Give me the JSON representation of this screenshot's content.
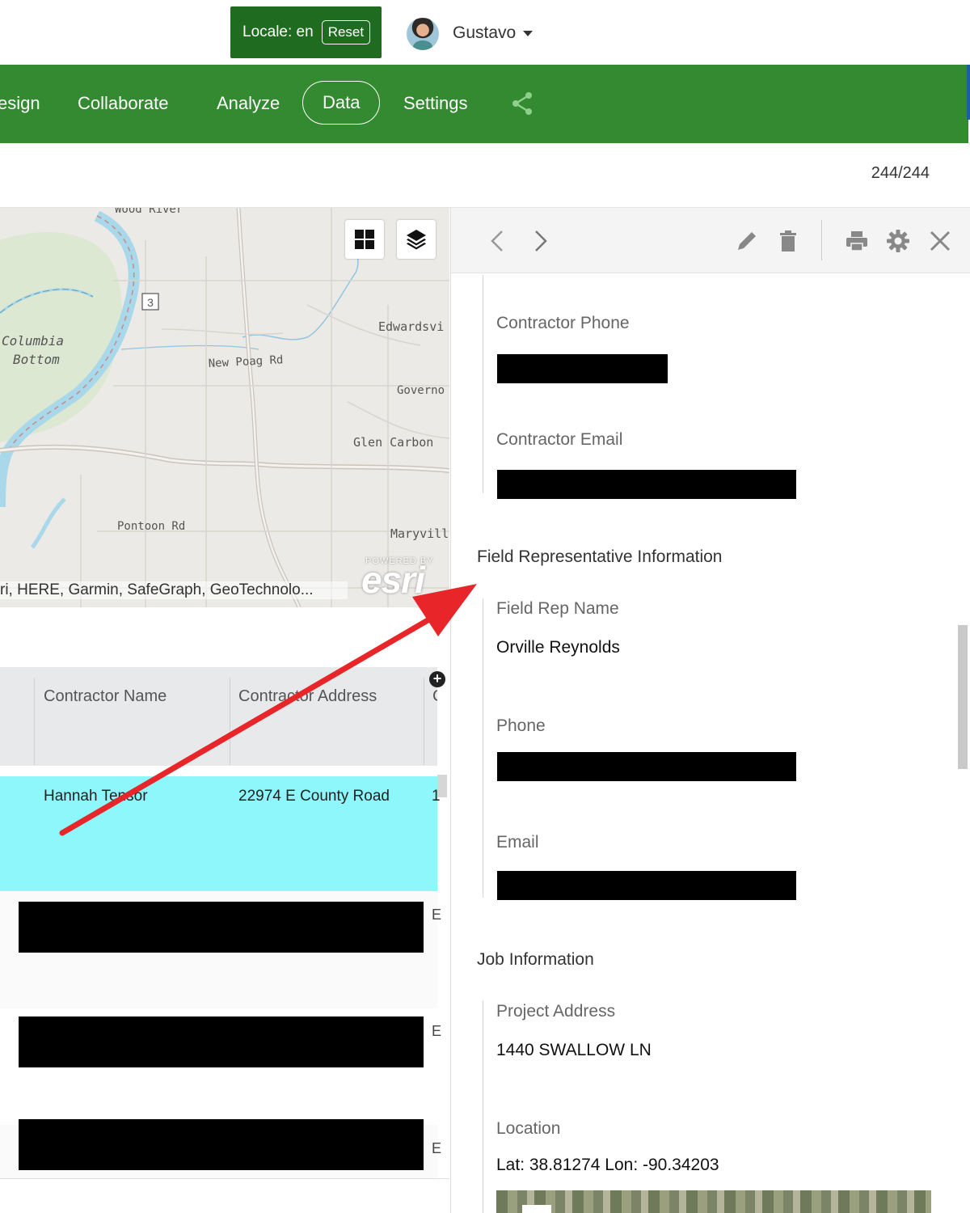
{
  "header": {
    "locale_label": "Locale: en",
    "reset_label": "Reset",
    "user_name": "Gustavo"
  },
  "nav": {
    "items": [
      {
        "label": "esign"
      },
      {
        "label": "Collaborate"
      },
      {
        "label": "Analyze"
      },
      {
        "label": "Data"
      },
      {
        "label": "Settings"
      }
    ],
    "active": "Data",
    "share_icon": "share-icon",
    "color": "#338a30"
  },
  "record_counter": "244/244",
  "map": {
    "labels": {
      "wood_river": "Wood River",
      "columbia_bottom_1": "Columbia",
      "columbia_bottom_2": "Bottom",
      "edwardsville": "Edwardsvi",
      "new_poag": "New Poag Rd",
      "governor": "Governo",
      "glen_carbon": "Glen Carbon",
      "pontoon": "Pontoon Rd",
      "maryville": "Maryville",
      "route": "3"
    },
    "attribution": "ri, HERE, Garmin, SafeGraph, GeoTechnolo...",
    "powered_by": "POWERED BY",
    "esri": "esri",
    "buttons": [
      "grid-icon",
      "layers-icon"
    ]
  },
  "table": {
    "columns": [
      "Contractor Name",
      "Contractor Address"
    ],
    "selected_row": {
      "contractor_name": "Hannah Tensor",
      "contractor_address": "22974 E County Road",
      "extra": "1"
    },
    "row_fragments": [
      "E",
      "E",
      "E"
    ],
    "selected_color": "#8ef7fb"
  },
  "panel": {
    "toolbar_icons": [
      "chevron-left-icon",
      "chevron-right-icon",
      "pencil-icon",
      "trash-icon",
      "print-icon",
      "gear-icon",
      "close-icon"
    ],
    "fields": {
      "contractor_phone_label": "Contractor Phone",
      "contractor_email_label": "Contractor Email",
      "field_rep_section": "Field Representative Information",
      "field_rep_name_label": "Field Rep Name",
      "field_rep_name_value": "Orville Reynolds",
      "phone_label": "Phone",
      "email_label": "Email",
      "job_section": "Job Information",
      "project_address_label": "Project Address",
      "project_address_value": "1440 SWALLOW LN",
      "location_label": "Location",
      "location_value": "Lat: 38.81274 Lon: -90.34203"
    }
  },
  "annotation_color": "#e8262a"
}
